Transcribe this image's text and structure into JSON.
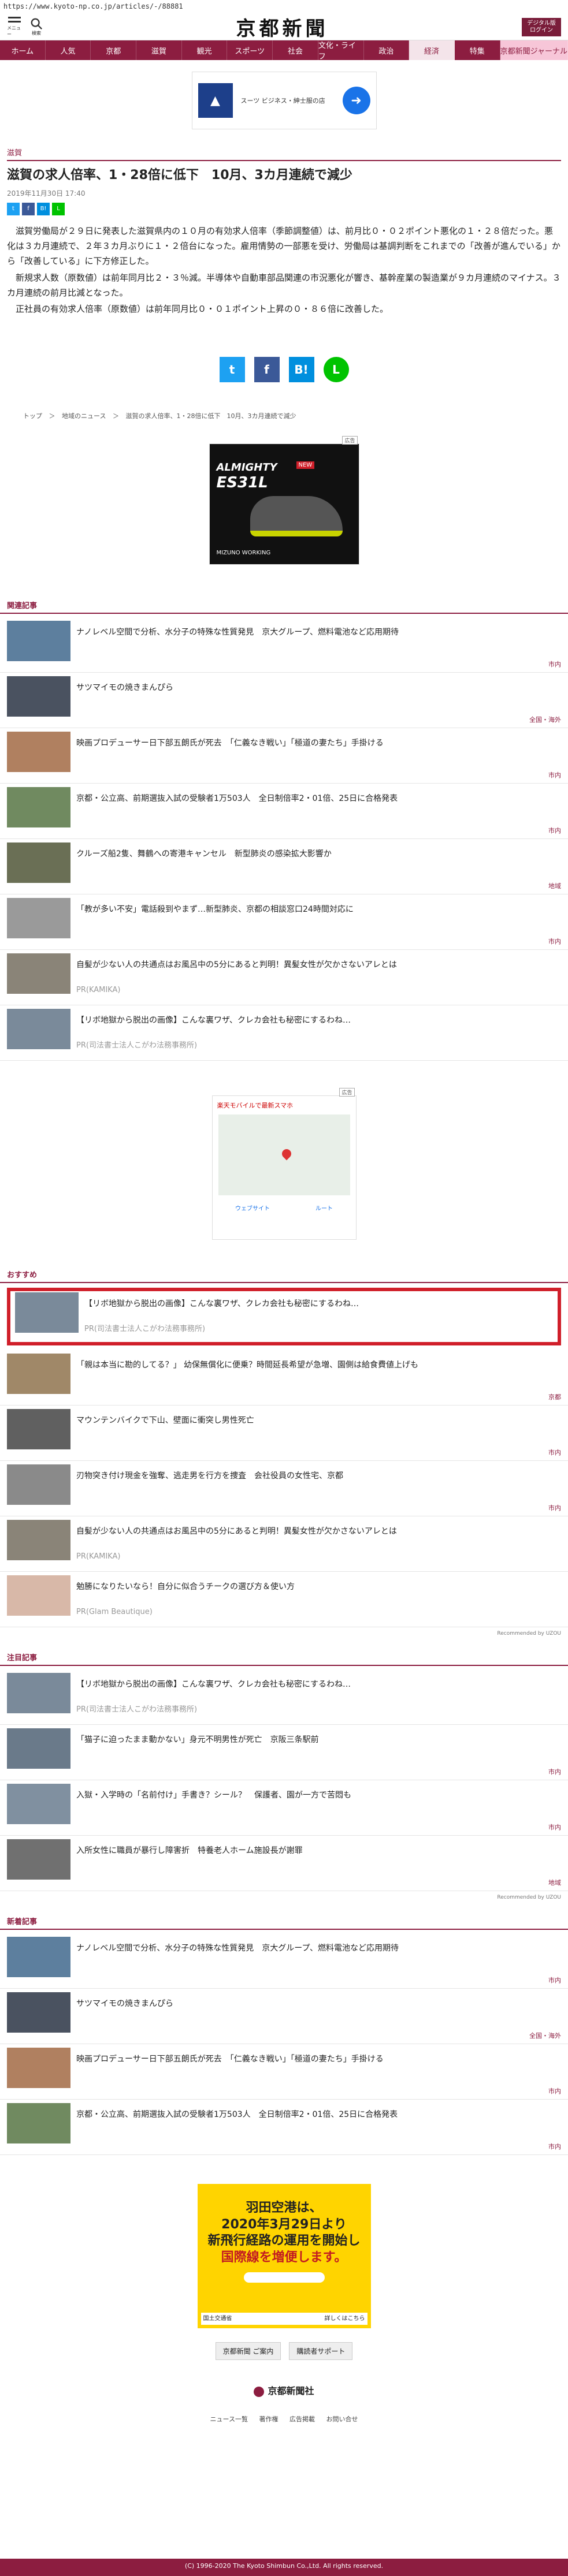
{
  "url": "https://www.kyoto-np.co.jp/articles/-/88881",
  "header": {
    "menu_label": "メニュー",
    "search_label": "検索",
    "logo": "京都新聞",
    "digital_button": "デジタル版 ログイン"
  },
  "nav": [
    "ホーム",
    "人気",
    "京都",
    "滋賀",
    "観光",
    "スポーツ",
    "社会",
    "文化・ライフ",
    "政治",
    "経済",
    "特集",
    "京都新聞ジャーナル"
  ],
  "ads": {
    "top_text": "スーツ ビジネス・紳士服の店",
    "shoe_brand": "ALMIGHTY",
    "shoe_model": "ES31L",
    "shoe_badge": "NEW",
    "shoe_footer": "MIZUNO WORKING",
    "map_header": "楽天モバイルで最新スマホ",
    "map_btn1": "ウェブサイト",
    "map_btn2": "ルート",
    "bottom_line1": "羽田空港は、",
    "bottom_line2": "2020年3月29日より",
    "bottom_line3": "新飛行経路の運用を開始し",
    "bottom_line4": "国際線を増便します。",
    "bottom_org": "国土交通省",
    "bottom_more": "詳しくはこちら",
    "ad_tag": "広告"
  },
  "article": {
    "category": "滋賀",
    "headline": "滋賀の求人倍率、1・28倍に低下　10月、3カ月連続で減少",
    "date": "2019年11月30日 17:40",
    "paragraphs": [
      "　滋賀労働局が２９日に発表した滋賀県内の１０月の有効求人倍率（季節調整値）は、前月比０・０２ポイント悪化の１・２８倍だった。悪化は３カ月連続で、２年３カ月ぶりに１・２倍台になった。雇用情勢の一部悪を受け、労働局は基調判断をこれまでの「改善が進んでいる」から「改善している」に下方修正した。",
      "　新規求人数（原数値）は前年同月比２・３％減。半導体や自動車部品関連の市況悪化が響き、基幹産業の製造業が９カ月連続のマイナス。３カ月連続の前月比減となった。",
      "　正社員の有効求人倍率（原数値）は前年同月比０・０１ポイント上昇の０・８６倍に改善した。"
    ],
    "share": [
      "t",
      "f",
      "B!",
      "L"
    ]
  },
  "breadcrumb": [
    "トップ",
    "＞",
    "地域のニュース",
    "＞",
    "滋賀の求人倍率、1・28倍に低下　10月、3カ月連続で減少"
  ],
  "related": {
    "title": "関連記事",
    "items": [
      {
        "text": "ナノレベル空間で分析、水分子の特殊な性質発見　京大グループ、燃料電池など応用期待",
        "tag": "市内",
        "pr": ""
      },
      {
        "text": "サツマイモの焼きまんぴら",
        "tag": "全国・海外",
        "pr": ""
      },
      {
        "text": "映画プロデューサー日下部五朗氏が死去　「仁義なき戦い」「極道の妻たち」手掛ける",
        "tag": "市内",
        "pr": ""
      },
      {
        "text": "京都・公立高、前期選抜入試の受験者1万503人　全日制倍率2・01倍、25日に合格発表",
        "tag": "市内",
        "pr": ""
      },
      {
        "text": "クルーズ船2隻、舞鶴への寄港キャンセル　新型肺炎の感染拡大影響か",
        "tag": "地域",
        "pr": ""
      },
      {
        "text": "「教が多い不安」電話殺到やまず…新型肺炎、京都の相談窓口24時間対応に",
        "tag": "市内",
        "pr": ""
      },
      {
        "text": "自髪が少ない人の共通点はお風呂中の5分にあると判明！異髪女性が欠かさないアレとは",
        "tag": "",
        "pr": "PR(KAMIKA)"
      },
      {
        "text": "【リボ地獄から脱出の画像】こんな裏ワザ、クレカ会社も秘密にするわね…",
        "tag": "",
        "pr": "PR(司法書士法人こがわ法務事務所)"
      }
    ]
  },
  "recommend": {
    "title": "おすすめ",
    "items": [
      {
        "text": "【リボ地獄から脱出の画像】こんな裏ワザ、クレカ会社も秘密にするわね…",
        "tag": "",
        "pr": "PR(司法書士法人こがわ法務事務所)"
      },
      {
        "text": "「親は本当に勘的してる？」 幼保無償化に便乗？時間延長希望が急増、園側は給食費値上げも",
        "tag": "京都",
        "pr": ""
      },
      {
        "text": "マウンテンバイクで下山、壁面に衝突し男性死亡",
        "tag": "市内",
        "pr": ""
      },
      {
        "text": "刃物突き付け現金を強奪、逃走男を行方を捜査　会社役員の女性宅、京都",
        "tag": "市内",
        "pr": ""
      },
      {
        "text": "自髪が少ない人の共通点はお風呂中の5分にあると判明！異髪女性が欠かさないアレとは",
        "tag": "",
        "pr": "PR(KAMIKA)"
      },
      {
        "text": "勉勝になりたいなら！自分に似合うチークの選び方＆使い方",
        "tag": "",
        "pr": "PR(Glam Beautique)"
      }
    ],
    "recommended_by": "Recommended by UZOU"
  },
  "attention": {
    "title": "注目記事",
    "items": [
      {
        "text": "【リボ地獄から脱出の画像】こんな裏ワザ、クレカ会社も秘密にするわね…",
        "tag": "",
        "pr": "PR(司法書士法人こがわ法務事務所)"
      },
      {
        "text": "「猫子に迫ったまま動かない」身元不明男性が死亡　京阪三条駅前",
        "tag": "市内",
        "pr": ""
      },
      {
        "text": "入獄・入学時の「名前付け」手書き？シール？　保護者、園が一方で苦悶も",
        "tag": "市内",
        "pr": ""
      },
      {
        "text": "入所女性に職員が暴行し障害折　特養老人ホーム施設長が謝罪",
        "tag": "地域",
        "pr": ""
      }
    ],
    "recommended_by": "Recommended by UZOU"
  },
  "latest": {
    "title": "新着記事",
    "items": [
      {
        "text": "ナノレベル空間で分析、水分子の特殊な性質発見　京大グループ、燃料電池など応用期待",
        "tag": "市内",
        "pr": ""
      },
      {
        "text": "サツマイモの焼きまんぴら",
        "tag": "全国・海外",
        "pr": ""
      },
      {
        "text": "映画プロデューサー日下部五朗氏が死去　「仁義なき戦い」「極道の妻たち」手掛ける",
        "tag": "市内",
        "pr": ""
      },
      {
        "text": "京都・公立高、前期選抜入試の受験者1万503人　全日制倍率2・01倍、25日に合格発表",
        "tag": "市内",
        "pr": ""
      }
    ]
  },
  "bottom_buttons": [
    "京都新聞 ご案内",
    "購読者サポート"
  ],
  "footer": {
    "logo": "京都新聞社",
    "links": [
      "ニュース一覧",
      "著作権",
      "広告掲載",
      "お問い合せ"
    ],
    "copyright": "(C) 1996-2020 The Kyoto Shimbun Co.,Ltd. All rights reserved."
  }
}
